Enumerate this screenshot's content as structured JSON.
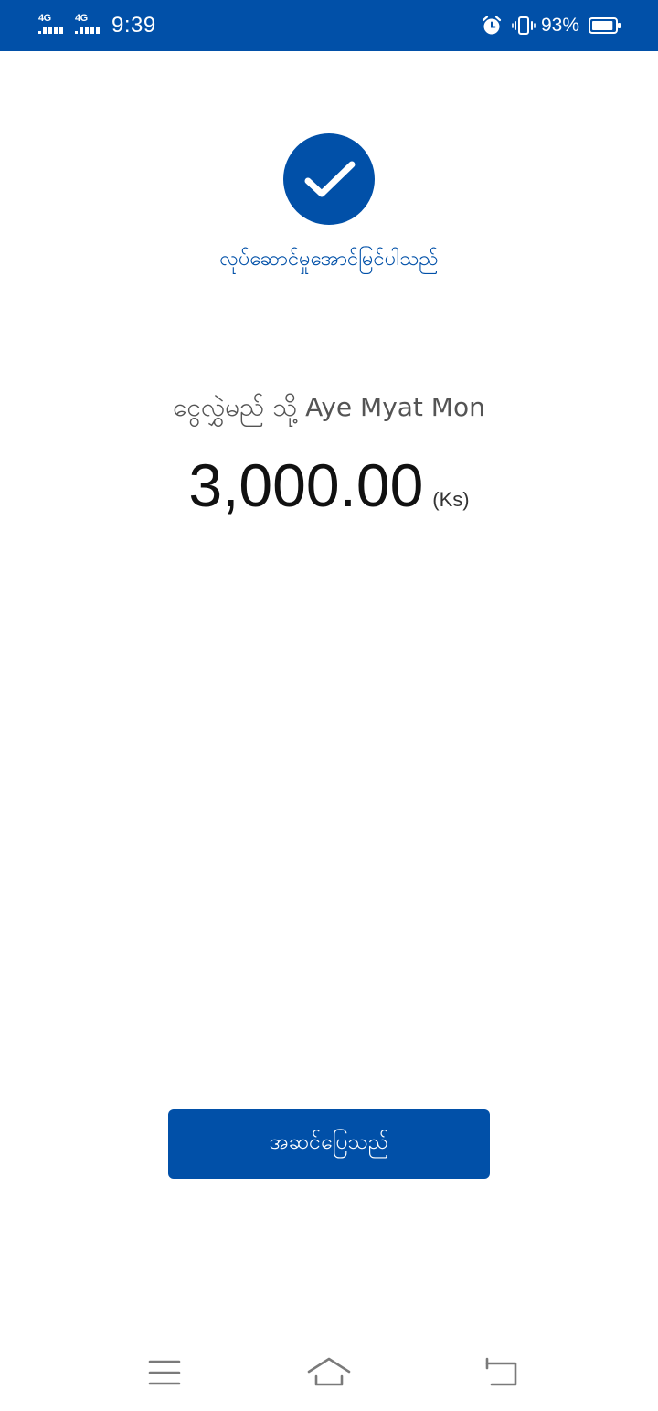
{
  "status_bar": {
    "network_1": "4G",
    "network_2": "4G",
    "time": "9:39",
    "battery_percent": "93%",
    "battery_level": 0.93,
    "icons": [
      "alarm-icon",
      "vibrate-icon",
      "battery-icon"
    ]
  },
  "result": {
    "icon": "checkmark-icon",
    "message": "လုပ်ဆောင်မှုအောင်မြင်ပါသည်",
    "recipient_text": "ငွေလွှဲမည် သို့ Aye Myat Mon",
    "amount": "3,000.00",
    "currency": "(Ks)"
  },
  "actions": {
    "close_label": "အဆင်ပြေသည်"
  },
  "nav_bar": {
    "icons": [
      "menu-icon",
      "home-icon",
      "back-icon"
    ]
  },
  "colors": {
    "brand": "#0150a8",
    "background": "#ffffff",
    "amount_text": "#111111",
    "secondary_text": "#545454"
  }
}
